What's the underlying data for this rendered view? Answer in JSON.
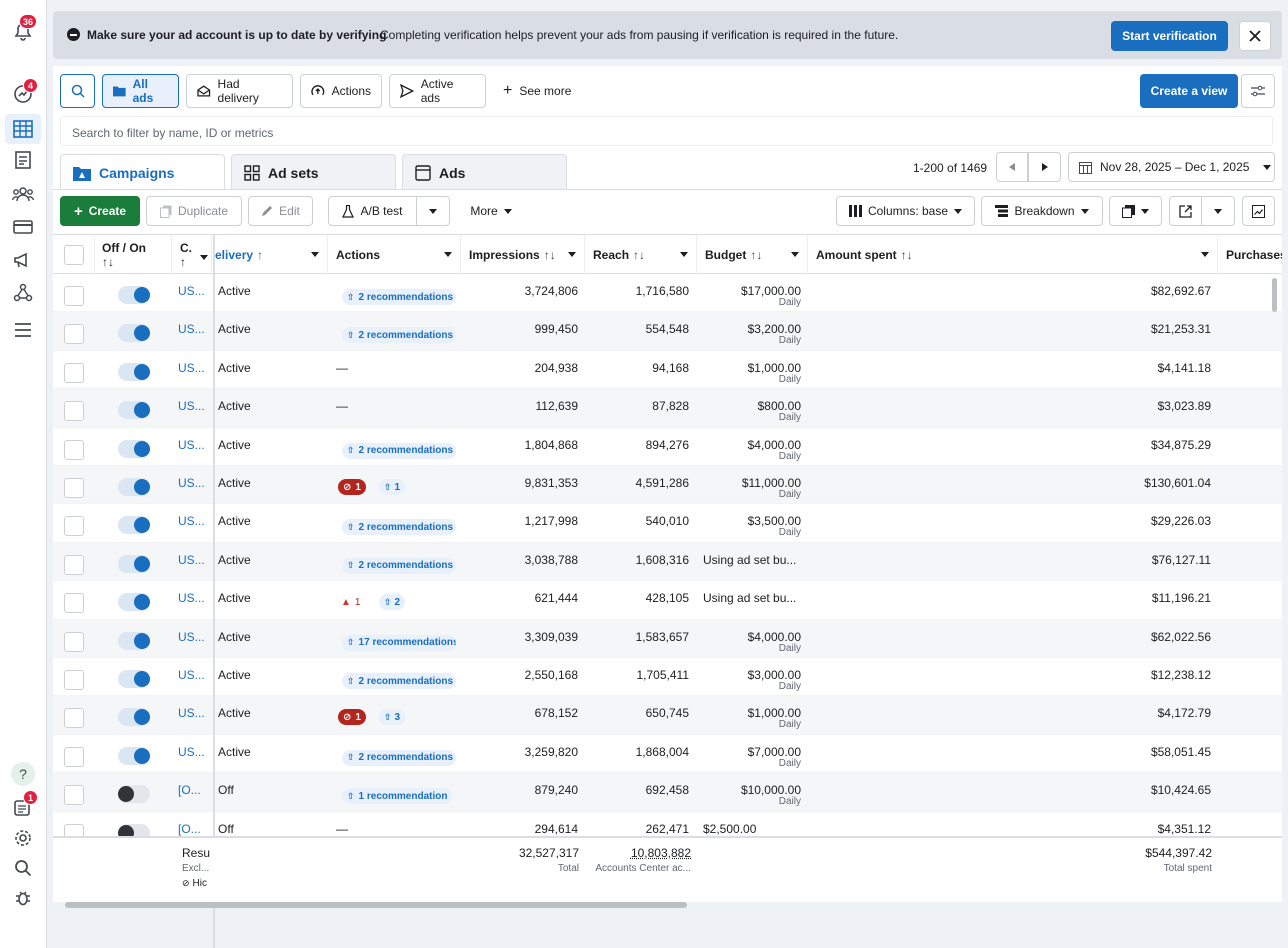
{
  "rail": {
    "notifications_badge": "36",
    "stats_badge": "4",
    "reports_badge": "1"
  },
  "banner": {
    "title": "Make sure your ad account is up to date by verifying",
    "message": "Completing verification helps prevent your ads from pausing if verification is required in the future.",
    "button": "Start verification"
  },
  "filters": {
    "all_ads": "All ads",
    "had_delivery": "Had delivery",
    "actions": "Actions",
    "active_ads": "Active ads",
    "see_more": "See more",
    "create_view": "Create a view"
  },
  "search": {
    "placeholder": "Search to filter by name, ID or metrics"
  },
  "tabs": {
    "campaigns": "Campaigns",
    "ad_sets": "Ad sets",
    "ads": "Ads"
  },
  "pagination": {
    "range": "1-200 of 1469",
    "date_range": "Nov 28, 2025 – Dec 1, 2025"
  },
  "toolbar": {
    "create": "Create",
    "duplicate": "Duplicate",
    "edit": "Edit",
    "ab_test": "A/B test",
    "more": "More",
    "columns": "Columns: base",
    "breakdown": "Breakdown"
  },
  "columns": {
    "off_on": "Off / On",
    "name": "C.",
    "delivery": "elivery",
    "actions": "Actions",
    "impressions": "Impressions",
    "reach": "Reach",
    "budget": "Budget",
    "amount_spent": "Amount spent",
    "purchases": "Purchases"
  },
  "sort_icon": "↑↓",
  "rows": [
    {
      "on": true,
      "name": "US...",
      "delivery": "Active",
      "actions": {
        "type": "rec",
        "label": "2 recommendations"
      },
      "impressions": "3,724,806",
      "reach": "1,716,580",
      "budget": "$17,000.00",
      "budget_type": "Daily",
      "spent": "$82,692.67"
    },
    {
      "on": true,
      "name": "US...",
      "delivery": "Active",
      "actions": {
        "type": "rec",
        "label": "2 recommendations"
      },
      "impressions": "999,450",
      "reach": "554,548",
      "budget": "$3,200.00",
      "budget_type": "Daily",
      "spent": "$21,253.31"
    },
    {
      "on": true,
      "name": "US...",
      "delivery": "Active",
      "actions": {
        "type": "dash",
        "label": "—"
      },
      "impressions": "204,938",
      "reach": "94,168",
      "budget": "$1,000.00",
      "budget_type": "Daily",
      "spent": "$4,141.18"
    },
    {
      "on": true,
      "name": "US...",
      "delivery": "Active",
      "actions": {
        "type": "dash",
        "label": "—"
      },
      "impressions": "112,639",
      "reach": "87,828",
      "budget": "$800.00",
      "budget_type": "Daily",
      "spent": "$3,023.89"
    },
    {
      "on": true,
      "name": "US...",
      "delivery": "Active",
      "actions": {
        "type": "rec",
        "label": "2 recommendations"
      },
      "impressions": "1,804,868",
      "reach": "894,276",
      "budget": "$4,000.00",
      "budget_type": "Daily",
      "spent": "$34,875.29"
    },
    {
      "on": true,
      "name": "US...",
      "delivery": "Active",
      "actions": {
        "type": "err",
        "err": "1",
        "rec": "1"
      },
      "impressions": "9,831,353",
      "reach": "4,591,286",
      "budget": "$11,000.00",
      "budget_type": "Daily",
      "spent": "$130,601.04"
    },
    {
      "on": true,
      "name": "US...",
      "delivery": "Active",
      "actions": {
        "type": "rec",
        "label": "2 recommendations"
      },
      "impressions": "1,217,998",
      "reach": "540,010",
      "budget": "$3,500.00",
      "budget_type": "Daily",
      "spent": "$29,226.03"
    },
    {
      "on": true,
      "name": "US...",
      "delivery": "Active",
      "actions": {
        "type": "rec",
        "label": "2 recommendations"
      },
      "impressions": "3,038,788",
      "reach": "1,608,316",
      "budget": "Using ad set bu...",
      "budget_type": "",
      "spent": "$76,127.11"
    },
    {
      "on": true,
      "name": "US...",
      "delivery": "Active",
      "actions": {
        "type": "warn",
        "err": "1",
        "rec": "2"
      },
      "impressions": "621,444",
      "reach": "428,105",
      "budget": "Using ad set bu...",
      "budget_type": "",
      "spent": "$11,196.21"
    },
    {
      "on": true,
      "name": "US...",
      "delivery": "Active",
      "actions": {
        "type": "rec",
        "label": "17 recommendations"
      },
      "impressions": "3,309,039",
      "reach": "1,583,657",
      "budget": "$4,000.00",
      "budget_type": "Daily",
      "spent": "$62,022.56"
    },
    {
      "on": true,
      "name": "US...",
      "delivery": "Active",
      "actions": {
        "type": "rec",
        "label": "2 recommendations"
      },
      "impressions": "2,550,168",
      "reach": "1,705,411",
      "budget": "$3,000.00",
      "budget_type": "Daily",
      "spent": "$12,238.12"
    },
    {
      "on": true,
      "name": "US...",
      "delivery": "Active",
      "actions": {
        "type": "err",
        "err": "1",
        "rec": "3"
      },
      "impressions": "678,152",
      "reach": "650,745",
      "budget": "$1,000.00",
      "budget_type": "Daily",
      "spent": "$4,172.79"
    },
    {
      "on": true,
      "name": "US...",
      "delivery": "Active",
      "actions": {
        "type": "rec",
        "label": "2 recommendations"
      },
      "impressions": "3,259,820",
      "reach": "1,868,004",
      "budget": "$7,000.00",
      "budget_type": "Daily",
      "spent": "$58,051.45"
    },
    {
      "on": false,
      "name": "[O...",
      "delivery": "Off",
      "actions": {
        "type": "rec",
        "label": "1 recommendation"
      },
      "impressions": "879,240",
      "reach": "692,458",
      "budget": "$10,000.00",
      "budget_type": "Daily",
      "spent": "$10,424.65"
    },
    {
      "on": false,
      "name": "[O...",
      "delivery": "Off",
      "actions": {
        "type": "dash",
        "label": "—"
      },
      "impressions": "294,614",
      "reach": "262,471",
      "budget": "$2,500.00",
      "budget_type": "",
      "spent": "$4,351.12"
    }
  ],
  "footer": {
    "results": "Resu",
    "excl": "Excl...",
    "hidden": "Hic",
    "impressions": "32,527,317",
    "impressions_label": "Total",
    "reach": "10,803,882",
    "reach_label": "Accounts Center ac...",
    "spent": "$544,397.42",
    "spent_label": "Total spent"
  }
}
